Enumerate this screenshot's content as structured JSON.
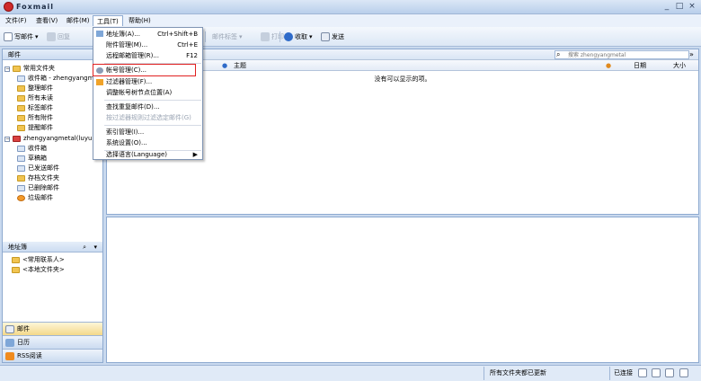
{
  "window": {
    "title": "Foxmail",
    "controls": [
      "_",
      "□",
      "×"
    ]
  },
  "menubar": [
    "文件(F)",
    "查看(V)",
    "邮件(M)",
    "工具(T)",
    "帮助(H)"
  ],
  "toolbar": {
    "compose": "写邮件",
    "reply": "回复",
    "mail_tag": "邮件标签",
    "print": "打印",
    "receive": "收取",
    "send": "发送"
  },
  "sidebar": {
    "header": "邮件",
    "local_folders": {
      "label": "常用文件夹",
      "items": [
        "收件箱 - zhengyangmetal",
        "整理邮件",
        "所有未读",
        "标签邮件",
        "所有附件",
        "提醒邮件"
      ]
    },
    "account": {
      "label": "zhengyangmetal(luyu)",
      "items": [
        "收件箱",
        "草稿箱",
        "已发送邮件",
        "存档文件夹",
        "已删除邮件",
        "垃圾邮件"
      ]
    },
    "addressbook": {
      "header": "地址簿",
      "items": [
        "<常用联系人>",
        "<本地文件夹>"
      ]
    },
    "nav": [
      "邮件",
      "日历",
      "RSS阅读"
    ]
  },
  "list": {
    "search_placeholder": "搜索 zhengyangmetal",
    "columns": [
      "主题",
      "日期",
      "大小"
    ],
    "empty": "没有可以显示的项。"
  },
  "tools_menu": [
    {
      "label": "地址簿(A)...",
      "shortcut": "Ctrl+Shift+B"
    },
    {
      "label": "附件管理(M)...",
      "shortcut": "Ctrl+E"
    },
    {
      "label": "远程邮箱管理(R)...",
      "shortcut": "F12"
    },
    {
      "label": "帐号管理(C)..."
    },
    {
      "label": "过滤器管理(F)..."
    },
    {
      "label": "调整帐号树节点位置(A)"
    },
    {
      "label": "查找重复邮件(D)..."
    },
    {
      "label": "按过滤器规则过滤选定邮件(G)",
      "disabled": true
    },
    {
      "label": "索引管理(I)..."
    },
    {
      "label": "系统设置(O)..."
    },
    {
      "label": "选择语言(Language)",
      "submenu": "▶"
    }
  ],
  "status": {
    "text": "所有文件夹都已更新",
    "connection": "已连接"
  },
  "colors": {
    "highlight_border": "#e02020",
    "accent": "#8eaad0"
  }
}
